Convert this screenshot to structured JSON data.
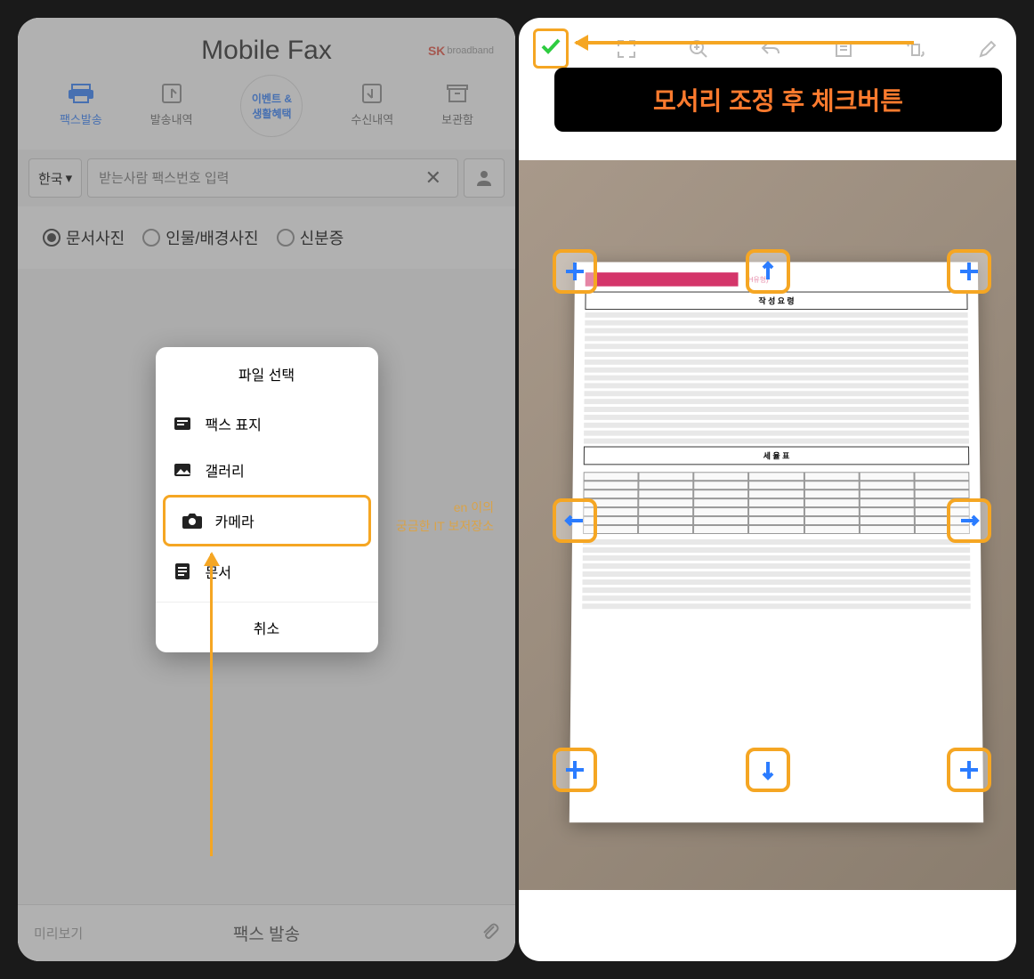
{
  "left": {
    "app_title": "Mobile Fax",
    "brand_prefix": "SK",
    "brand_name": "broadband",
    "tabs": [
      {
        "label": "팩스발송",
        "active": true
      },
      {
        "label": "발송내역"
      },
      {
        "label_line1": "이벤트 &",
        "label_line2": "생활혜택",
        "circled": true
      },
      {
        "label": "수신내역"
      },
      {
        "label": "보관함"
      }
    ],
    "country": "한국",
    "fax_placeholder": "받는사람 팩스번호 입력",
    "radios": [
      {
        "label": "문서사진",
        "checked": true
      },
      {
        "label": "인물/배경사진",
        "checked": false
      },
      {
        "label": "신분증",
        "checked": false
      }
    ],
    "modal": {
      "title": "파일 선택",
      "items": [
        {
          "label": "팩스 표지",
          "icon": "fax-cover"
        },
        {
          "label": "갤러리",
          "icon": "gallery"
        },
        {
          "label": "카메라",
          "icon": "camera",
          "highlight": true
        },
        {
          "label": "문서",
          "icon": "document"
        }
      ],
      "cancel": "취소"
    },
    "preview": "미리보기",
    "send": "팩스 발송",
    "watermark_line1": "en 이의",
    "watermark_line2": "궁금한 IT 보저장소"
  },
  "right": {
    "annotation": "모서리 조정 후 체크버튼",
    "doc_type": "(H유형)",
    "doc_section1": "작 성 요 령",
    "doc_section2": "세 율 표"
  }
}
